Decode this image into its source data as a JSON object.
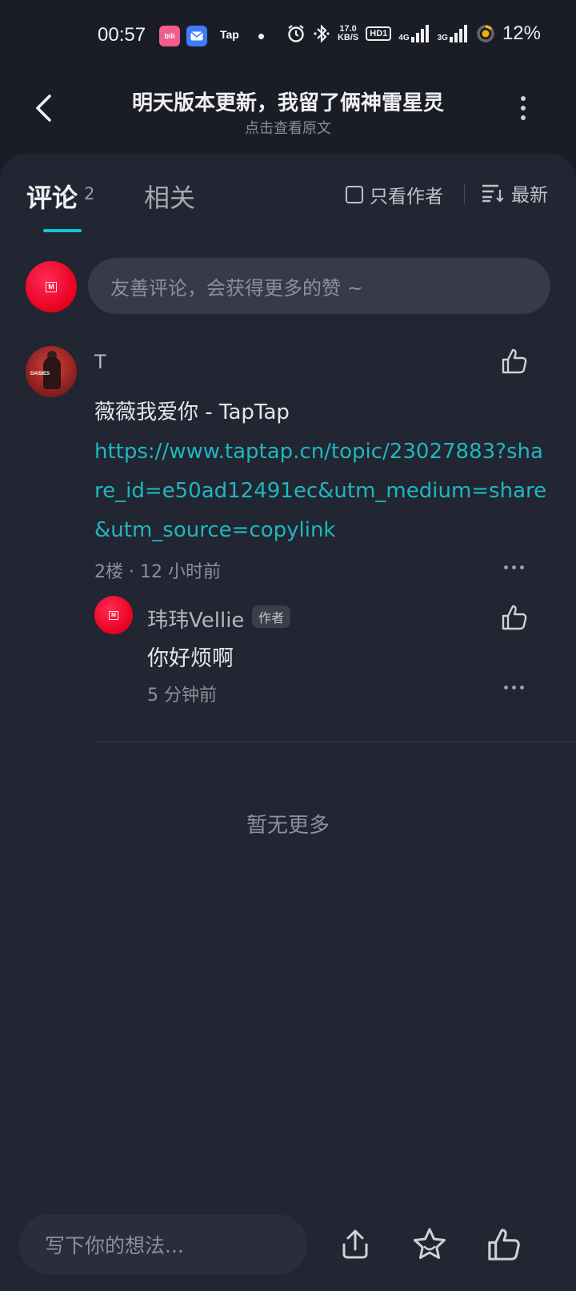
{
  "status_bar": {
    "time": "00:57",
    "apps": [
      "bilibili",
      "mail",
      "Tap"
    ],
    "speed_top": "17.0",
    "speed_unit": "KB/S",
    "hd": "HD1",
    "net1": "4G",
    "net2": "3G",
    "battery": "12%"
  },
  "header": {
    "title": "明天版本更新，我留了俩神雷星灵",
    "subtitle": "点击查看原文"
  },
  "tabs": {
    "comment_label": "评论",
    "comment_count": "2",
    "related_label": "相关",
    "author_only": "只看作者",
    "sort_label": "最新"
  },
  "composer": {
    "placeholder": "友善评论，会获得更多的赞 ~"
  },
  "comment": {
    "user": "T",
    "text": "薇薇我爱你 - TapTap",
    "link": "https://www.taptap.cn/topic/23027883?share_id=e50ad12491ec&utm_medium=share&utm_source=copylink",
    "meta": "2楼 · 12 小时前",
    "reply": {
      "user": "玮玮Vellie",
      "badge": "作者",
      "text": "你好烦啊",
      "meta": "5 分钟前"
    }
  },
  "footer": {
    "no_more": "暂无更多",
    "reply_placeholder": "写下你的想法..."
  },
  "colors": {
    "accent": "#15c5ce",
    "link": "#1fb7bf",
    "background": "#1b1d26",
    "panel": "#222532"
  }
}
